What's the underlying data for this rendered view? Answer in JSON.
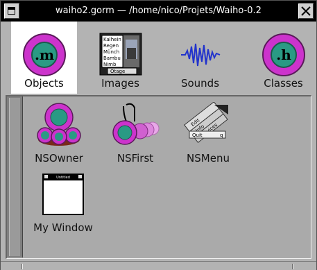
{
  "window": {
    "title": "waiho2.gorm  —  /home/nico/Projets/Waiho-0.2"
  },
  "toolbar": {
    "items": [
      {
        "label": "Objects",
        "icon": "objects-icon",
        "selected": true
      },
      {
        "label": "Images",
        "icon": "images-icon",
        "selected": false
      },
      {
        "label": "Sounds",
        "icon": "sounds-icon",
        "selected": false
      },
      {
        "label": "Classes",
        "icon": "classes-icon",
        "selected": false
      }
    ]
  },
  "objects": {
    "items": [
      {
        "label": "NSOwner",
        "icon": "nsowner-icon"
      },
      {
        "label": "NSFirst",
        "icon": "nsfirst-icon"
      },
      {
        "label": "NSMenu",
        "icon": "nsmenu-icon"
      },
      {
        "label": "My Window",
        "icon": "window-icon"
      }
    ]
  },
  "icon_text": {
    "objects_glyph": ".m",
    "classes_glyph": ".h",
    "images_list": [
      "Kalhein",
      "Regen",
      "Münch",
      "Bambu",
      "Nimb"
    ],
    "images_button": "Otage",
    "menu_items": [
      "Edit",
      "Quit",
      "Services",
      "Info"
    ],
    "menu_shortcut": "q",
    "window_title": "Untitled"
  },
  "colors": {
    "accent_magenta": "#cc33cc",
    "accent_teal": "#2a9a84",
    "title_bar": "#000000",
    "window_bg": "#b3b3b3",
    "sounds_wave": "#2233cc"
  }
}
